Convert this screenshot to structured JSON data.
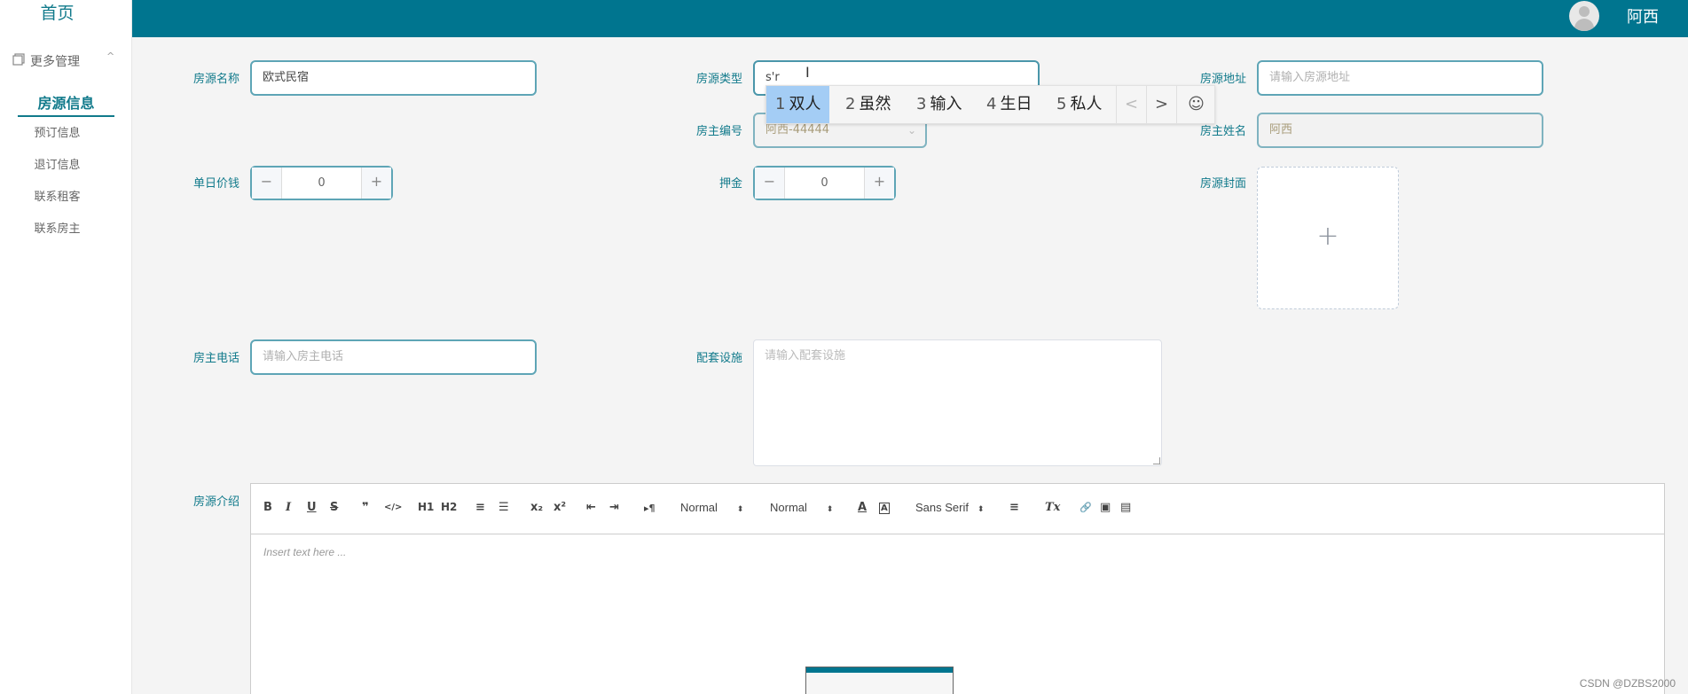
{
  "sidebar": {
    "home": "首页",
    "group_label": "更多管理",
    "group_chevron": "^",
    "items": [
      {
        "label": "房源信息"
      },
      {
        "label": "预订信息"
      },
      {
        "label": "退订信息"
      },
      {
        "label": "联系租客"
      },
      {
        "label": "联系房主"
      }
    ]
  },
  "header": {
    "username": "阿西"
  },
  "form": {
    "name_label": "房源名称",
    "name_value": "欧式民宿",
    "type_label": "房源类型",
    "type_value": "s'r",
    "address_label": "房源地址",
    "address_placeholder": "请输入房源地址",
    "owner_id_label": "房主编号",
    "owner_id_value": "阿西-44444",
    "owner_name_label": "房主姓名",
    "owner_name_value": "阿西",
    "price_label": "单日价钱",
    "price_value": "0",
    "deposit_label": "押金",
    "deposit_value": "0",
    "cover_label": "房源封面",
    "cover_plus": "+",
    "phone_label": "房主电话",
    "phone_placeholder": "请输入房主电话",
    "facility_label": "配套设施",
    "facility_placeholder": "请输入配套设施",
    "intro_label": "房源介绍"
  },
  "editor": {
    "toolbar": {
      "bold": "B",
      "italic": "I",
      "underline": "U",
      "strike": "S",
      "quote": "❞",
      "code": "</>",
      "h1": "H1",
      "h2": "H2",
      "ordered": "≡",
      "bullet": "☰",
      "sub": "x₂",
      "sup": "x²",
      "outdent": "⇤",
      "indent": "⇥",
      "direction": "▸¶",
      "size_value": "Normal",
      "header_value": "Normal",
      "color": "A",
      "background": "A",
      "font_value": "Sans Serif",
      "align": "≡",
      "clean": "Tx",
      "link": "🔗",
      "image": "▣",
      "video": "▤"
    },
    "placeholder": "Insert text here ..."
  },
  "ime": {
    "candidates": [
      {
        "num": "1",
        "text": "双人"
      },
      {
        "num": "2",
        "text": "虽然"
      },
      {
        "num": "3",
        "text": "输入"
      },
      {
        "num": "4",
        "text": "生日"
      },
      {
        "num": "5",
        "text": "私人"
      }
    ],
    "prev": "<",
    "next": ">",
    "emoji": "☺"
  },
  "watermark": "CSDN @DZBS2000"
}
